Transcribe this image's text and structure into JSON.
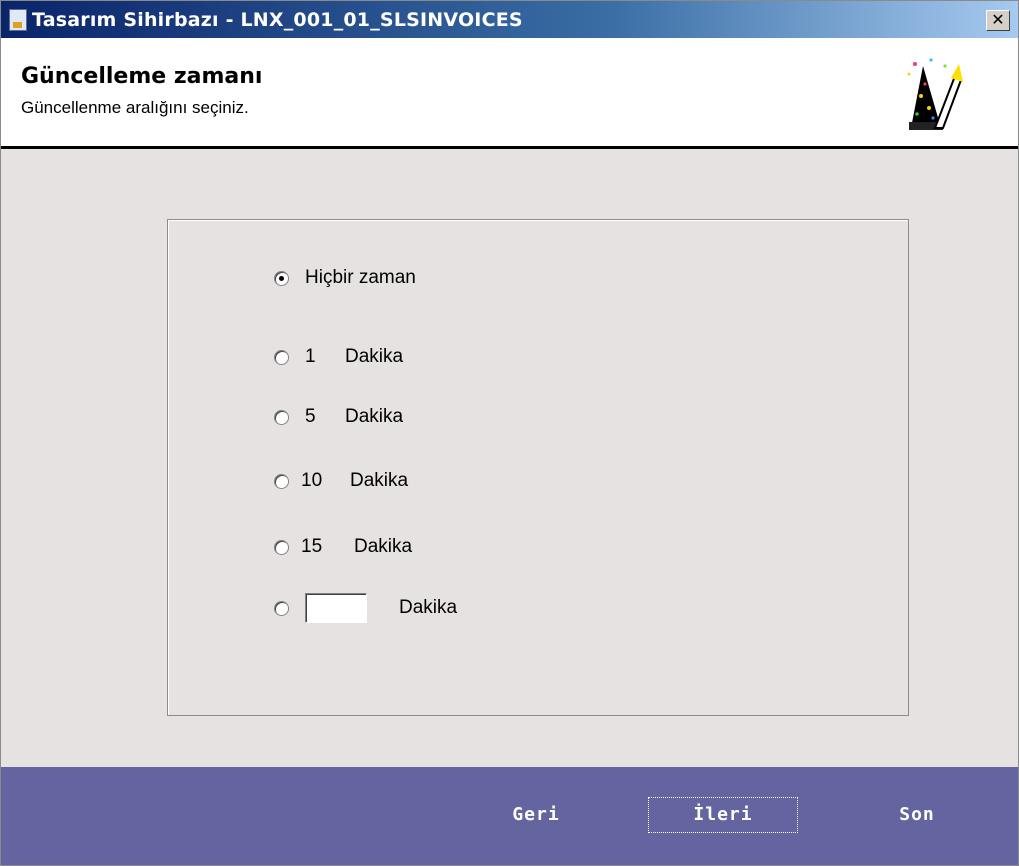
{
  "window": {
    "title": "Tasarım Sihirbazı - LNX_001_01_SLSINVOICES",
    "close_glyph": "✕"
  },
  "header": {
    "title": "Güncelleme zamanı",
    "subtitle": "Güncellenme aralığını seçiniz.",
    "icon": "wizard-hat-icon"
  },
  "options": [
    {
      "label": "Hiçbir zaman",
      "checked": true
    },
    {
      "number": "1",
      "unit": "Dakika",
      "checked": false
    },
    {
      "number": "5",
      "unit": "Dakika",
      "checked": false
    },
    {
      "number": "10",
      "unit": "Dakika",
      "checked": false
    },
    {
      "number": "15",
      "unit": "Dakika",
      "checked": false
    }
  ],
  "custom_option": {
    "value": "",
    "unit": "Dakika",
    "checked": false
  },
  "footer": {
    "back_label": "Geri",
    "next_label": "İleri",
    "finish_label": "Son",
    "background_color": "#6464a0"
  }
}
